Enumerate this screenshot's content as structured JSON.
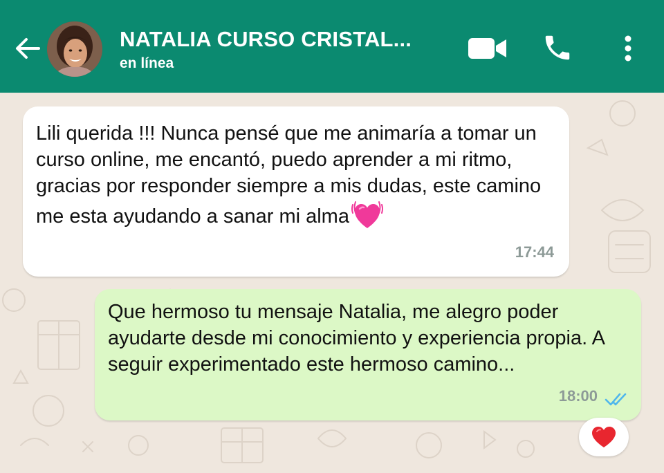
{
  "header": {
    "contact_name": "NATALIA CURSO CRISTAL...",
    "status": "en línea",
    "background_color": "#0b8a70",
    "icons": [
      "back-arrow-icon",
      "video-call-icon",
      "phone-icon",
      "more-options-icon"
    ]
  },
  "messages": [
    {
      "direction": "incoming",
      "text": "Lili querida !!! Nunca pensé que me animaría a tomar un curso online, me encantó, puedo aprender a mi ritmo, gracias por responder siempre a mis dudas, este camino me esta ayudando a sanar mi alma",
      "emoji": "beating-heart-icon",
      "time": "17:44"
    },
    {
      "direction": "outgoing",
      "text": "Que hermoso tu mensaje Natalia, me alegro poder ayudarte desde mi conocimiento y experiencia propia. A seguir experimentado este hermoso camino...",
      "time": "18:00",
      "read_status_icon": "double-check-read-icon",
      "reaction": "red-heart-icon"
    }
  ],
  "colors": {
    "incoming_bubble": "#ffffff",
    "outgoing_bubble": "#dcf8c6",
    "chat_background": "#efe7de",
    "read_ticks": "#4fb6ec"
  }
}
